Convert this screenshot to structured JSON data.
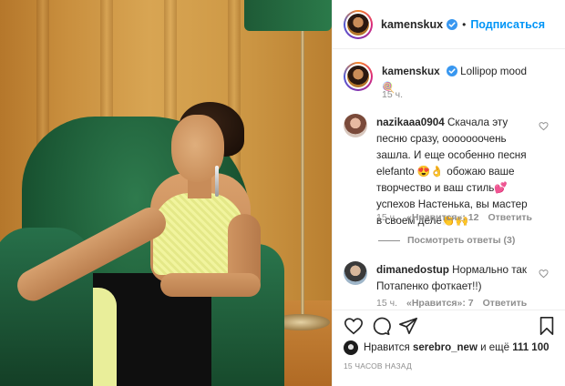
{
  "header": {
    "username": "kamenskux",
    "dot": "•",
    "follow_label": "Подписаться"
  },
  "caption": {
    "username": "kamenskux",
    "text": "Lollipop mood 🍭",
    "time": "15 ч."
  },
  "comments": [
    {
      "username": "nazikaaa0904",
      "text": "Скачала эту песню сразу, ооооооочень зашла. И еще особенно песня elefanto 😍👌 обожаю ваше творчество и ваш стиль💕 успехов Настенька, вы мастер в своем деле👏🙌",
      "time": "15 ч.",
      "likes": "«Нравится»: 12",
      "reply_label": "Ответить",
      "view_replies": "Посмотреть ответы (3)"
    },
    {
      "username": "dimanedostup",
      "text": "Нормально так Потапенко фоткает!!)",
      "time": "15 ч.",
      "likes": "«Нравится»: 7",
      "reply_label": "Ответить"
    }
  ],
  "actions": {
    "icons": [
      "heart-icon",
      "comment-icon",
      "share-icon",
      "bookmark-icon"
    ]
  },
  "likes_line": {
    "prefix": "Нравится",
    "user": "serebro_new",
    "middle": "и ещё",
    "count": "111 100"
  },
  "posted_ago": "15 ЧАСОВ НАЗАД",
  "colors": {
    "link_blue": "#0095f6",
    "verified_blue": "#3897f0",
    "muted": "#8e8e8e",
    "text": "#262626"
  }
}
